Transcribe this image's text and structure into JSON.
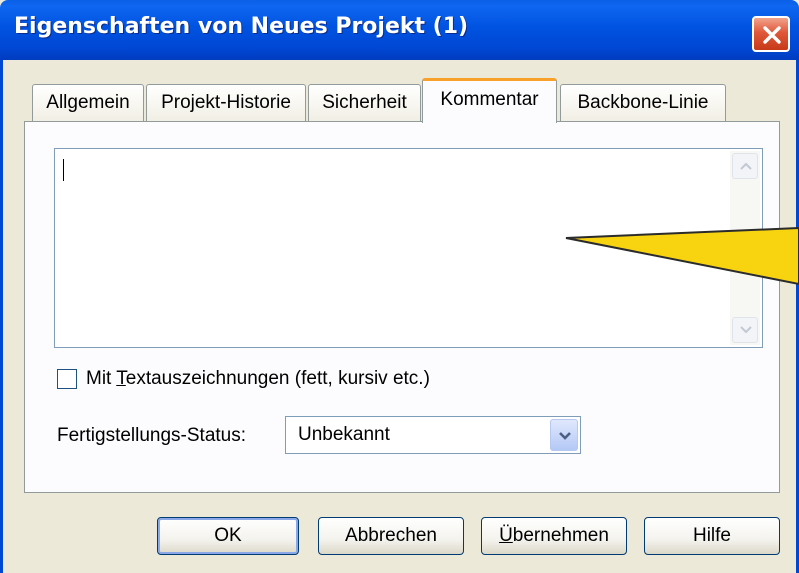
{
  "window": {
    "title": "Eigenschaften von Neues Projekt (1)",
    "close_icon": "close-icon"
  },
  "tabs": [
    {
      "label": "Allgemein",
      "active": false
    },
    {
      "label": "Projekt-Historie",
      "active": false
    },
    {
      "label": "Sicherheit",
      "active": false
    },
    {
      "label": "Kommentar",
      "active": true
    },
    {
      "label": "Backbone-Linie",
      "active": false
    }
  ],
  "comment": {
    "value": ""
  },
  "markup_checkbox": {
    "label_pre": "Mit ",
    "label_accel": "T",
    "label_post": "extauszeichnungen (fett, kursiv etc.)",
    "checked": false
  },
  "status": {
    "label": "Fertigstellungs-Status:",
    "value": "Unbekannt"
  },
  "buttons": {
    "ok": "OK",
    "cancel": "Abbrechen",
    "apply_accel": "Ü",
    "apply_rest": "bernehmen",
    "help": "Hilfe"
  },
  "colors": {
    "titlebar": "#0053e1",
    "face": "#ece9d8",
    "active_tab_accent": "#f8a12a",
    "callout": "#f8d410"
  }
}
